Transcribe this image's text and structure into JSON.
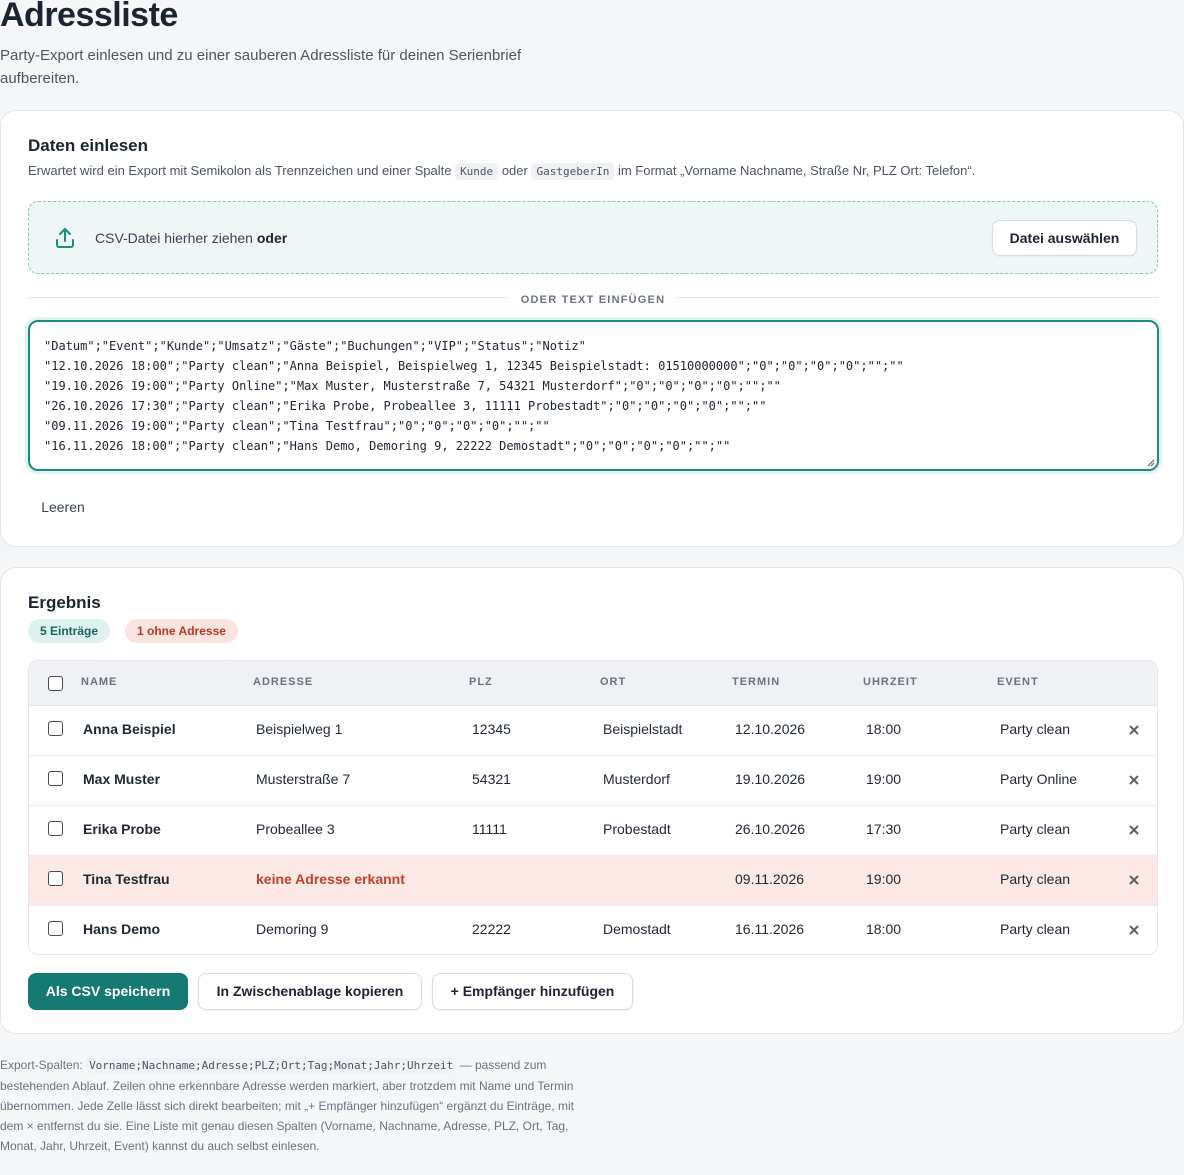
{
  "header": {
    "title": "Adressliste",
    "subtitle": "Party-Export einlesen und zu einer sauberen Adressliste für deinen Serienbrief aufbereiten."
  },
  "input_card": {
    "title": "Daten einlesen",
    "hint_prefix": "Erwartet wird ein Export mit Semikolon als Trennzeichen und einer Spalte",
    "hint_code1": "Kunde",
    "hint_or": "oder",
    "hint_code2": "GastgeberIn",
    "hint_suffix": "im Format „Vorname Nachname, Straße Nr, PLZ Ort: Telefon“.",
    "dropzone_text": "CSV-Datei hierher ziehen",
    "dropzone_or": "oder",
    "file_button": "Datei auswählen",
    "divider": "ODER TEXT EINFÜGEN",
    "textarea_lines": [
      "\"Datum\";\"Event\";\"Kunde\";\"Umsatz\";\"Gäste\";\"Buchungen\";\"VIP\";\"Status\";\"Notiz\"",
      "\"12.10.2026 18:00\";\"Party clean\";\"Anna Beispiel, Beispielweg 1, 12345 Beispielstadt: 01510000000\";\"0\";\"0\";\"0\";\"0\";\"\";\"\"",
      "\"19.10.2026 19:00\";\"Party Online\";\"Max Muster, Musterstraße 7, 54321 Musterdorf\";\"0\";\"0\";\"0\";\"0\";\"\";\"\"",
      "\"26.10.2026 17:30\";\"Party clean\";\"Erika Probe, Probeallee 3, 11111 Probestadt\";\"0\";\"0\";\"0\";\"0\";\"\";\"\"",
      "\"09.11.2026 19:00\";\"Party clean\";\"Tina Testfrau\";\"0\";\"0\";\"0\";\"0\";\"\";\"\"",
      "\"16.11.2026 18:00\";\"Party clean\";\"Hans Demo, Demoring 9, 22222 Demostadt\";\"0\";\"0\";\"0\";\"0\";\"\";\"\""
    ],
    "clear_button": "Leeren"
  },
  "result_card": {
    "title": "Ergebnis",
    "badge_count": "5 Einträge",
    "badge_missing": "1 ohne Adresse",
    "columns": [
      "NAME",
      "ADRESSE",
      "PLZ",
      "ORT",
      "TERMIN",
      "UHRZEIT",
      "EVENT"
    ],
    "rows": [
      {
        "name": "Anna Beispiel",
        "address": "Beispielweg 1",
        "plz": "12345",
        "ort": "Beispielstadt",
        "termin": "12.10.2026",
        "uhrzeit": "18:00",
        "event": "Party clean",
        "missing": false
      },
      {
        "name": "Max Muster",
        "address": "Musterstraße 7",
        "plz": "54321",
        "ort": "Musterdorf",
        "termin": "19.10.2026",
        "uhrzeit": "19:00",
        "event": "Party Online",
        "missing": false
      },
      {
        "name": "Erika Probe",
        "address": "Probeallee 3",
        "plz": "11111",
        "ort": "Probestadt",
        "termin": "26.10.2026",
        "uhrzeit": "17:30",
        "event": "Party clean",
        "missing": false
      },
      {
        "name": "Tina Testfrau",
        "address": "keine Adresse erkannt",
        "plz": "",
        "ort": "",
        "termin": "09.11.2026",
        "uhrzeit": "19:00",
        "event": "Party clean",
        "missing": true
      },
      {
        "name": "Hans Demo",
        "address": "Demoring 9",
        "plz": "22222",
        "ort": "Demostadt",
        "termin": "16.11.2026",
        "uhrzeit": "18:00",
        "event": "Party clean",
        "missing": false
      }
    ],
    "save_button": "Als CSV speichern",
    "copy_button": "In Zwischenablage kopieren",
    "add_button": "+ Empfänger hinzufügen"
  },
  "footer": {
    "prefix": "Export-Spalten:",
    "code": "Vorname;Nachname;Adresse;PLZ;Ort;Tag;Monat;Jahr;Uhrzeit",
    "text": "— passend zum bestehenden Ablauf. Zeilen ohne erkennbare Adresse werden markiert, aber trotzdem mit Name und Termin übernommen. Jede Zelle lässt sich direkt bearbeiten; mit „+ Empfänger hinzufügen“ ergänzt du Einträge, mit dem × entfernst du sie. Eine Liste mit genau diesen Spalten (Vorname, Nachname, Adresse, PLZ, Ort, Tag, Monat, Jahr, Uhrzeit, Event) kannst du auch selbst einlesen."
  },
  "colors": {
    "accent": "#157a71",
    "warn_bg": "#fce9e5",
    "warn_text": "#c0412c"
  }
}
